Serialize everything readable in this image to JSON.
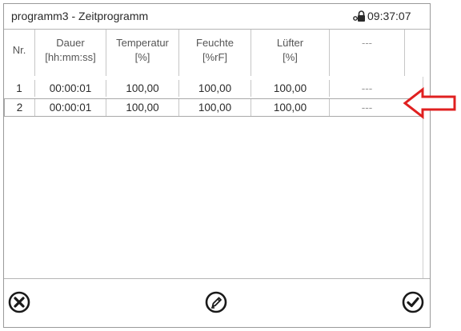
{
  "titlebar": {
    "title": "programm3 - Zeitprogramm",
    "clock": "09:37:07",
    "icon": "lock-key-icon"
  },
  "table": {
    "columns": [
      {
        "line1": "Nr.",
        "line2": ""
      },
      {
        "line1": "Dauer",
        "line2": "[hh:mm:ss]"
      },
      {
        "line1": "Temperatur",
        "line2": "[%]"
      },
      {
        "line1": "Feuchte",
        "line2": "[%rF]"
      },
      {
        "line1": "Lüfter",
        "line2": "[%]"
      },
      {
        "line1": "---",
        "line2": ""
      }
    ],
    "rows": [
      {
        "nr": "1",
        "dauer": "00:00:01",
        "temperatur": "100,00",
        "feuchte": "100,00",
        "luefter": "100,00",
        "extra": "---"
      },
      {
        "nr": "2",
        "dauer": "00:00:01",
        "temperatur": "100,00",
        "feuchte": "100,00",
        "luefter": "100,00",
        "extra": "---"
      }
    ],
    "selected_row": 2
  },
  "footer": {
    "cancel_icon": "close-circle-icon",
    "edit_icon": "pencil-circle-icon",
    "confirm_icon": "check-circle-icon"
  },
  "colors": {
    "annotation_arrow": "#e02020",
    "border": "#9a9a9a",
    "header_text": "#555555"
  }
}
